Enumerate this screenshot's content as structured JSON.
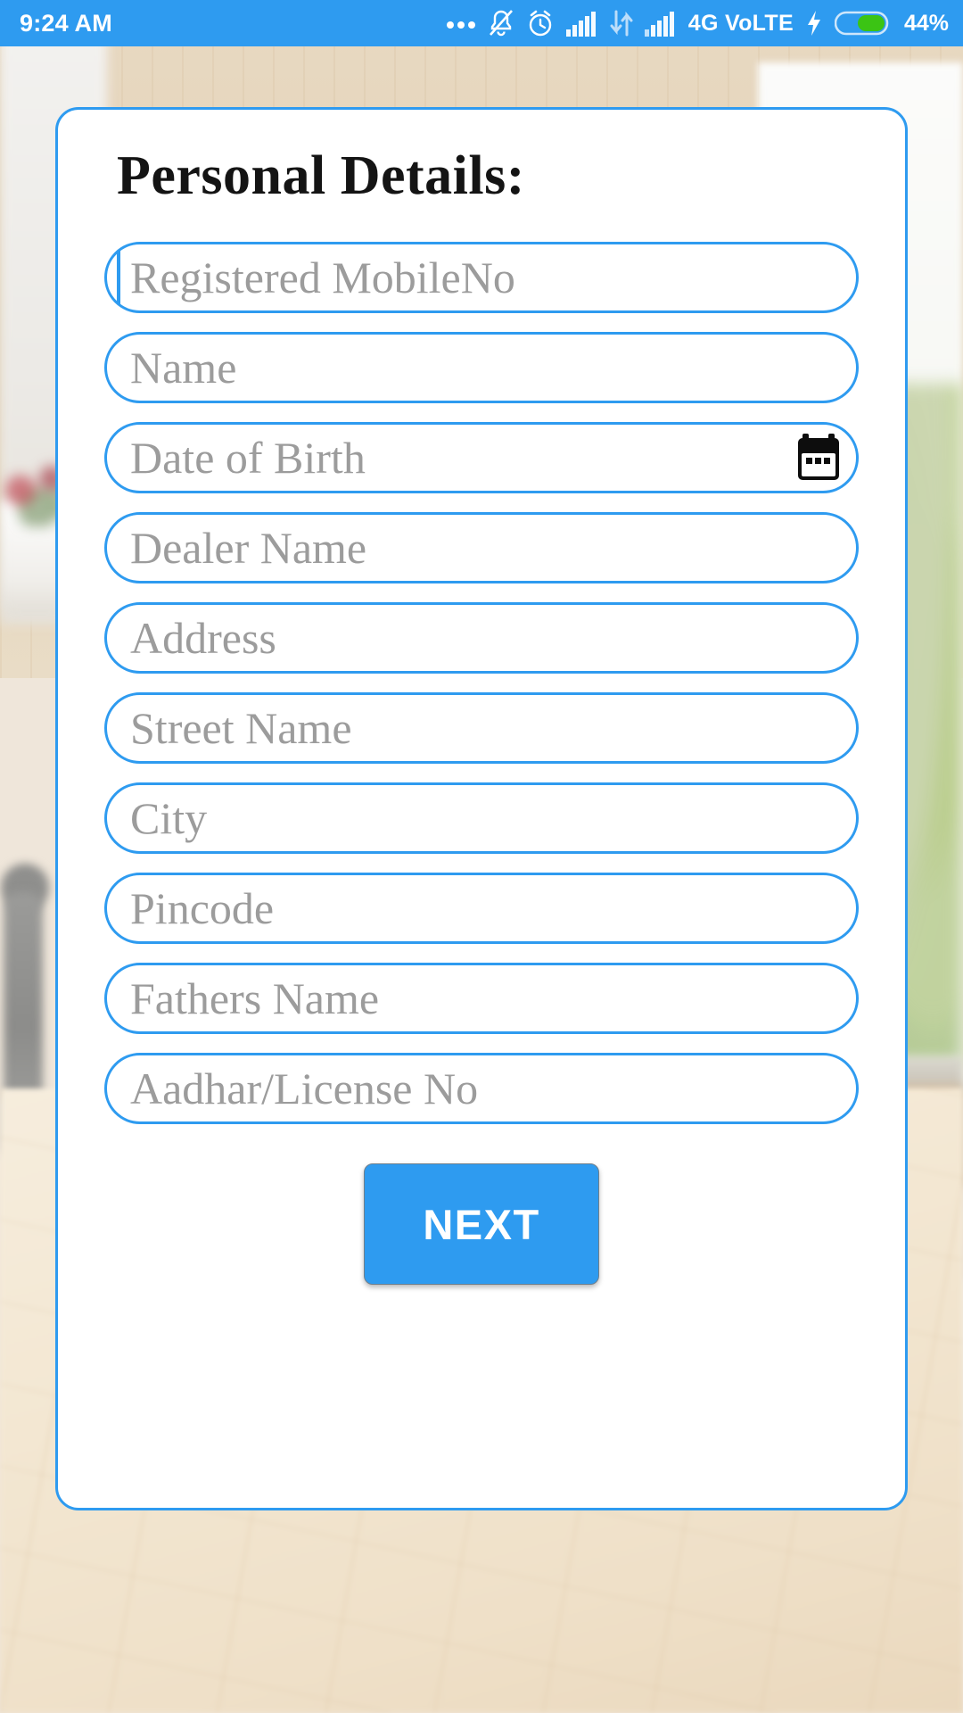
{
  "status_bar": {
    "time": "9:24 AM",
    "background_color": "#2E9BF0",
    "text_color": "#FFFFFF",
    "icons": [
      "more-notifications-icon",
      "bell-muted-icon",
      "alarm-clock-icon",
      "signal-bars-sim1-icon",
      "data-transfer-icon",
      "signal-bars-sim2-icon"
    ],
    "network_label": "4G VoLTE",
    "charging": true,
    "battery_percent_label": "44%",
    "battery_level": 44,
    "battery_fill_color": "#3BC414"
  },
  "card": {
    "title": "Personal Details:",
    "accent_color": "#2E9BF0",
    "background_color": "#FFFFFF",
    "placeholder_color": "#9C9C9C"
  },
  "form": {
    "fields": [
      {
        "name": "registered-mobile-no",
        "placeholder": "Registered MobileNo",
        "value": "",
        "focused": true,
        "has_calendar_icon": false
      },
      {
        "name": "name",
        "placeholder": "Name",
        "value": "",
        "focused": false,
        "has_calendar_icon": false
      },
      {
        "name": "date-of-birth",
        "placeholder": "Date of Birth",
        "value": "",
        "focused": false,
        "has_calendar_icon": true
      },
      {
        "name": "dealer-name",
        "placeholder": "Dealer Name",
        "value": "",
        "focused": false,
        "has_calendar_icon": false
      },
      {
        "name": "address",
        "placeholder": "Address",
        "value": "",
        "focused": false,
        "has_calendar_icon": false
      },
      {
        "name": "street-name",
        "placeholder": "Street Name",
        "value": "",
        "focused": false,
        "has_calendar_icon": false
      },
      {
        "name": "city",
        "placeholder": "City",
        "value": "",
        "focused": false,
        "has_calendar_icon": false
      },
      {
        "name": "pincode",
        "placeholder": "Pincode",
        "value": "",
        "focused": false,
        "has_calendar_icon": false
      },
      {
        "name": "fathers-name",
        "placeholder": "Fathers Name",
        "value": "",
        "focused": false,
        "has_calendar_icon": false
      },
      {
        "name": "aadhar-license-no",
        "placeholder": "Aadhar/License No",
        "value": "",
        "focused": false,
        "has_calendar_icon": false
      }
    ],
    "submit_label": "NEXT",
    "submit_color": "#2E9BF0"
  },
  "wallpaper": {
    "description": "blurred interior room photo: beige wood wall panels, white cabinet and potted plant at left, window with green foliage at right, light wood floor with grey rug at bottom"
  }
}
